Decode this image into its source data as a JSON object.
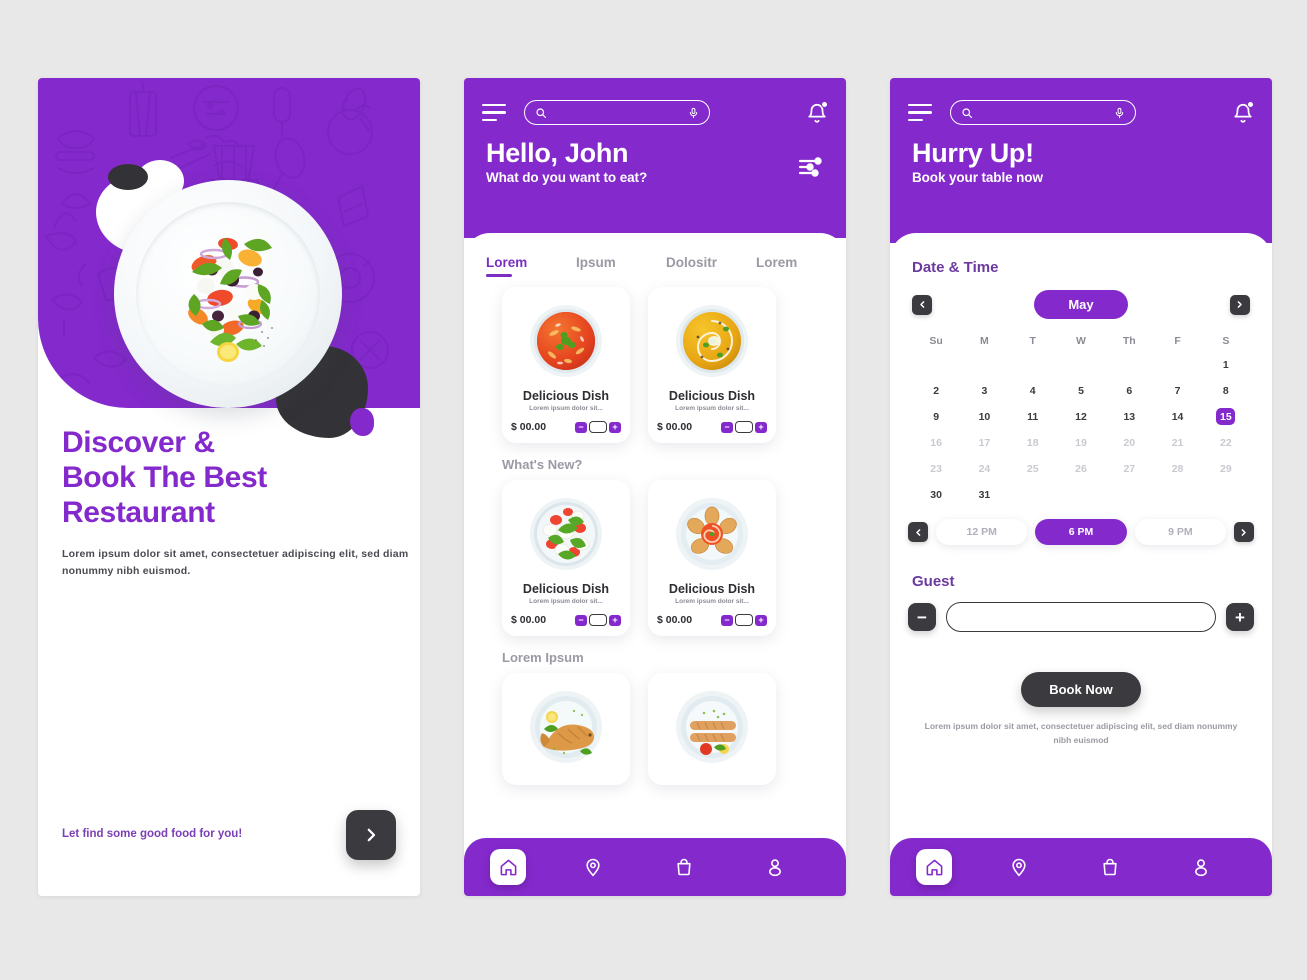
{
  "accent": {
    "purple": "#8429cc",
    "deep_purple": "#6b3a9e",
    "dark": "#3b3a3f",
    "muted": "#9a9aa4",
    "page_bg": "#e8e8e8"
  },
  "screen1": {
    "title_line1": "Discover &",
    "title_line2": "Book The Best",
    "title_line3": "Restaurant",
    "subtitle": "Lorem ipsum dolor sit amet, consectetuer adipiscing elit, sed diam nonummy nibh euismod.",
    "footer_text": "Let find some good food for you!",
    "next_icon": "chevron-right-icon",
    "hero_icon": "salad-plate-illustration"
  },
  "screen2": {
    "menu_icon": "hamburger-menu-icon",
    "search": {
      "value": "",
      "placeholder": "",
      "icon": "search-icon",
      "mic_icon": "microphone-icon"
    },
    "bell_icon": "notification-bell-icon",
    "greeting_title": "Hello, John",
    "greeting_sub": "What do you want to eat?",
    "filter_icon": "filter-sliders-icon",
    "tabs": [
      {
        "label": "Lorem",
        "active": true
      },
      {
        "label": "Ipsum",
        "active": false
      },
      {
        "label": "Dolositr",
        "active": false
      },
      {
        "label": "Lorem",
        "active": false
      }
    ],
    "sections": [
      {
        "heading": "",
        "cards": [
          {
            "name": "Delicious Dish",
            "desc": "Lorem ipsum dolor sit...",
            "price": "$ 00.00",
            "qty": "",
            "image": "tomato-soup-bowl"
          },
          {
            "name": "Delicious Dish",
            "desc": "Lorem ipsum dolor sit...",
            "price": "$ 00.00",
            "qty": "",
            "image": "pumpkin-soup-bowl"
          }
        ]
      },
      {
        "heading": "What's New?",
        "cards": [
          {
            "name": "Delicious Dish",
            "desc": "Lorem ipsum dolor sit...",
            "price": "$ 00.00",
            "qty": "",
            "image": "caprese-salad-bowl"
          },
          {
            "name": "Delicious Dish",
            "desc": "Lorem ipsum dolor sit...",
            "price": "$ 00.00",
            "qty": "",
            "image": "pastry-flower-plate"
          }
        ]
      },
      {
        "heading": "Lorem Ipsum",
        "cards": [
          {
            "name": "",
            "desc": "",
            "price": "",
            "qty": "",
            "image": "grilled-fish-plate"
          },
          {
            "name": "",
            "desc": "",
            "price": "",
            "qty": "",
            "image": "sausages-plate"
          }
        ]
      }
    ],
    "stepper": {
      "minus": "−",
      "plus": "+"
    },
    "bottom_nav": [
      {
        "icon": "home-icon",
        "active": true
      },
      {
        "icon": "location-pin-icon",
        "active": false
      },
      {
        "icon": "shopping-bag-icon",
        "active": false
      },
      {
        "icon": "user-profile-icon",
        "active": false
      }
    ]
  },
  "screen3": {
    "menu_icon": "hamburger-menu-icon",
    "search": {
      "value": "",
      "placeholder": "",
      "icon": "search-icon",
      "mic_icon": "microphone-icon"
    },
    "bell_icon": "notification-bell-icon",
    "greeting_title": "Hurry Up!",
    "greeting_sub": "Book your table now",
    "date_time_heading": "Date & Time",
    "month": "May",
    "prev_icon": "chevron-left-icon",
    "next_icon": "chevron-right-icon",
    "dow": [
      "Su",
      "M",
      "T",
      "W",
      "Th",
      "F",
      "S"
    ],
    "weeks": [
      [
        {
          "d": "",
          "s": "empty"
        },
        {
          "d": "",
          "s": "empty"
        },
        {
          "d": "",
          "s": "empty"
        },
        {
          "d": "",
          "s": "empty"
        },
        {
          "d": "",
          "s": "empty"
        },
        {
          "d": "",
          "s": "empty"
        },
        {
          "d": "1",
          "s": "normal"
        }
      ],
      [
        {
          "d": "2",
          "s": "normal"
        },
        {
          "d": "3",
          "s": "normal"
        },
        {
          "d": "4",
          "s": "normal"
        },
        {
          "d": "5",
          "s": "normal"
        },
        {
          "d": "6",
          "s": "normal"
        },
        {
          "d": "7",
          "s": "normal"
        },
        {
          "d": "8",
          "s": "normal"
        }
      ],
      [
        {
          "d": "9",
          "s": "normal"
        },
        {
          "d": "10",
          "s": "normal"
        },
        {
          "d": "11",
          "s": "normal"
        },
        {
          "d": "12",
          "s": "normal"
        },
        {
          "d": "13",
          "s": "normal"
        },
        {
          "d": "14",
          "s": "normal"
        },
        {
          "d": "15",
          "s": "sel"
        }
      ],
      [
        {
          "d": "16",
          "s": "muted"
        },
        {
          "d": "17",
          "s": "muted"
        },
        {
          "d": "18",
          "s": "muted"
        },
        {
          "d": "19",
          "s": "muted"
        },
        {
          "d": "20",
          "s": "muted"
        },
        {
          "d": "21",
          "s": "muted"
        },
        {
          "d": "22",
          "s": "muted"
        }
      ],
      [
        {
          "d": "23",
          "s": "muted"
        },
        {
          "d": "24",
          "s": "muted"
        },
        {
          "d": "25",
          "s": "muted"
        },
        {
          "d": "26",
          "s": "muted"
        },
        {
          "d": "27",
          "s": "muted"
        },
        {
          "d": "28",
          "s": "muted"
        },
        {
          "d": "29",
          "s": "muted"
        }
      ],
      [
        {
          "d": "30",
          "s": "normal"
        },
        {
          "d": "31",
          "s": "normal"
        },
        {
          "d": "",
          "s": "empty"
        },
        {
          "d": "",
          "s": "empty"
        },
        {
          "d": "",
          "s": "empty"
        },
        {
          "d": "",
          "s": "empty"
        },
        {
          "d": "",
          "s": "empty"
        }
      ]
    ],
    "times": [
      {
        "label": "12 PM",
        "selected": false
      },
      {
        "label": "6 PM",
        "selected": true
      },
      {
        "label": "9 PM",
        "selected": false
      }
    ],
    "time_prev_icon": "chevron-left-icon",
    "time_next_icon": "chevron-right-icon",
    "guest_heading": "Guest",
    "guest_value": "",
    "guest_placeholder": "",
    "guest_minus": "−",
    "guest_plus": "+",
    "book_button": "Book Now",
    "book_note": "Lorem ipsum dolor sit amet, consectetuer adipiscing elit, sed diam nonummy nibh euismod",
    "bottom_nav": [
      {
        "icon": "home-icon",
        "active": true
      },
      {
        "icon": "location-pin-icon",
        "active": false
      },
      {
        "icon": "shopping-bag-icon",
        "active": false
      },
      {
        "icon": "user-profile-icon",
        "active": false
      }
    ]
  }
}
